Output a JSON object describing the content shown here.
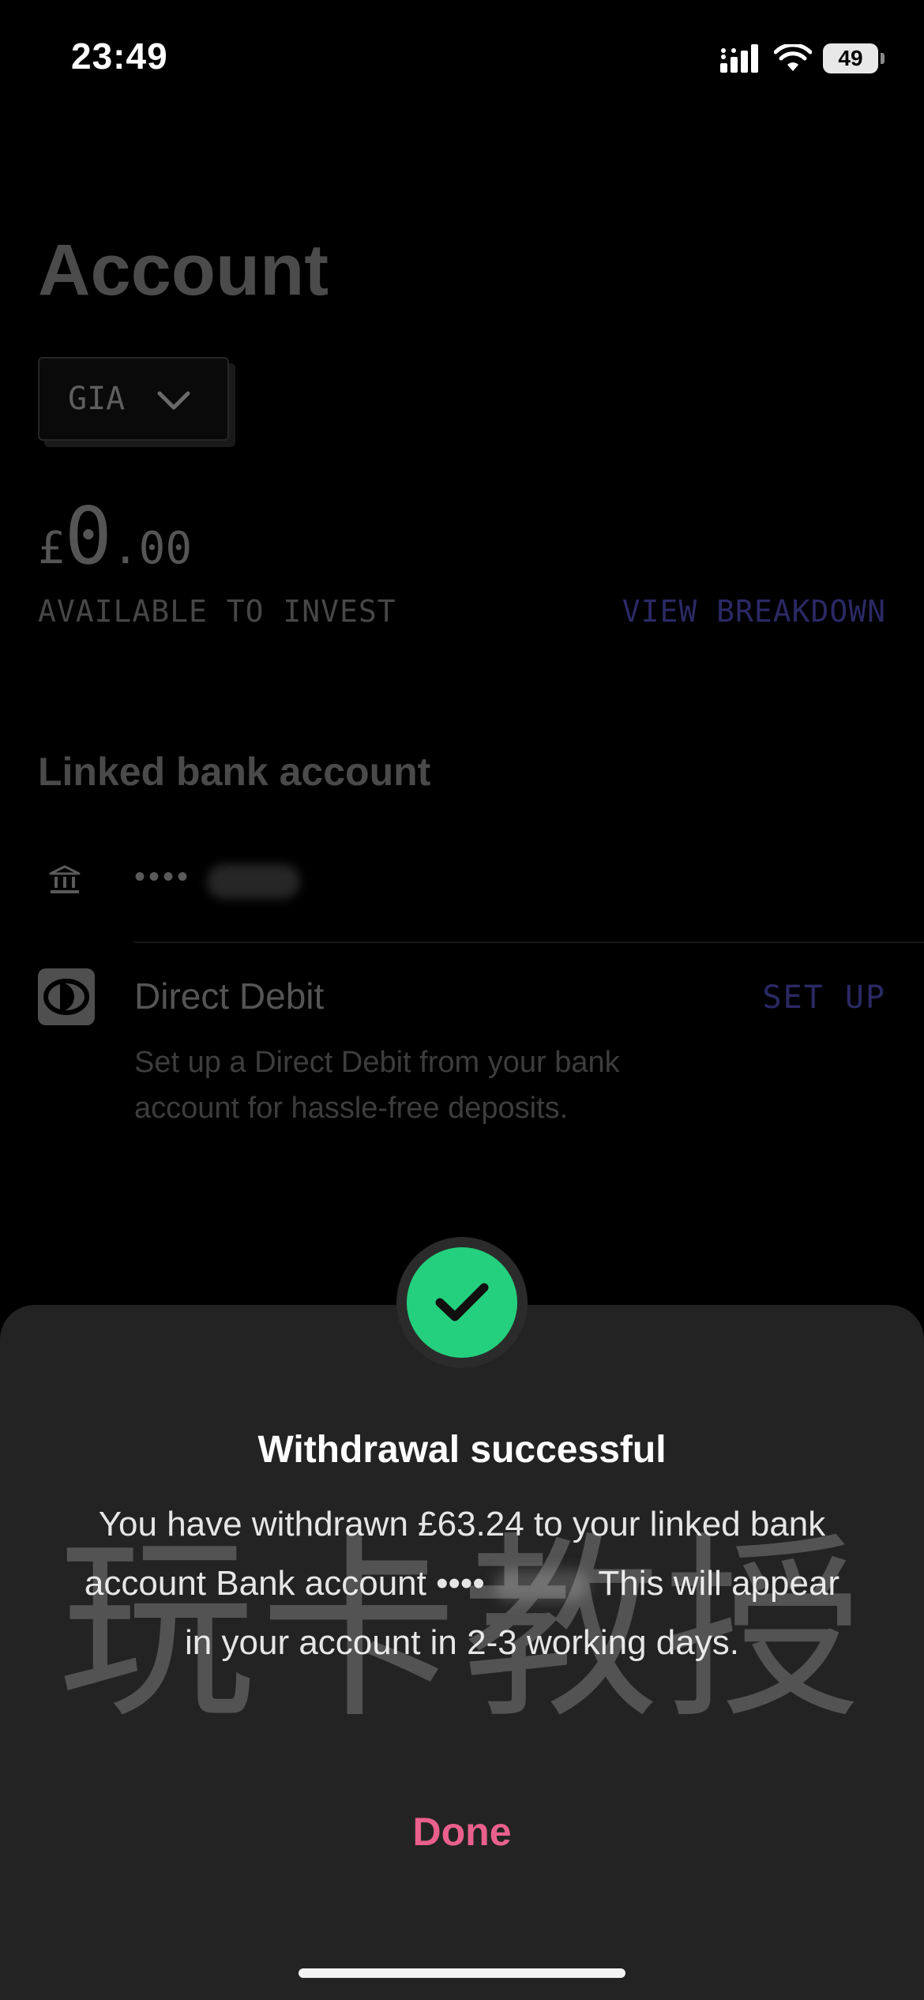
{
  "status_bar": {
    "time": "23:49",
    "battery": "49"
  },
  "account": {
    "title": "Account",
    "account_type": "GIA",
    "balance": {
      "currency": "£",
      "integer": "0",
      "decimal": ".00"
    },
    "available_label": "AVAILABLE TO INVEST",
    "view_breakdown": "VIEW BREAKDOWN",
    "linked_heading": "Linked bank account",
    "bank_mask": "••••",
    "direct_debit": {
      "title": "Direct Debit",
      "action": "SET UP",
      "description": "Set up a Direct Debit from your bank account for hassle-free deposits."
    }
  },
  "sheet": {
    "title": "Withdrawal successful",
    "message_before": "You have withdrawn £63.24 to your linked bank account Bank account ••••",
    "message_after": "This will appear in your account in 2-3 working days.",
    "done_label": "Done"
  },
  "watermark": "玩卡教授",
  "colors": {
    "success": "#24d07d",
    "accent_link": "#2b2964",
    "done": "#e9608c",
    "sheet_bg": "#232323"
  },
  "icons": [
    "cellular-signal-icon",
    "wifi-icon",
    "battery-icon",
    "chevron-down-icon",
    "bank-icon",
    "direct-debit-icon",
    "checkmark-icon"
  ]
}
